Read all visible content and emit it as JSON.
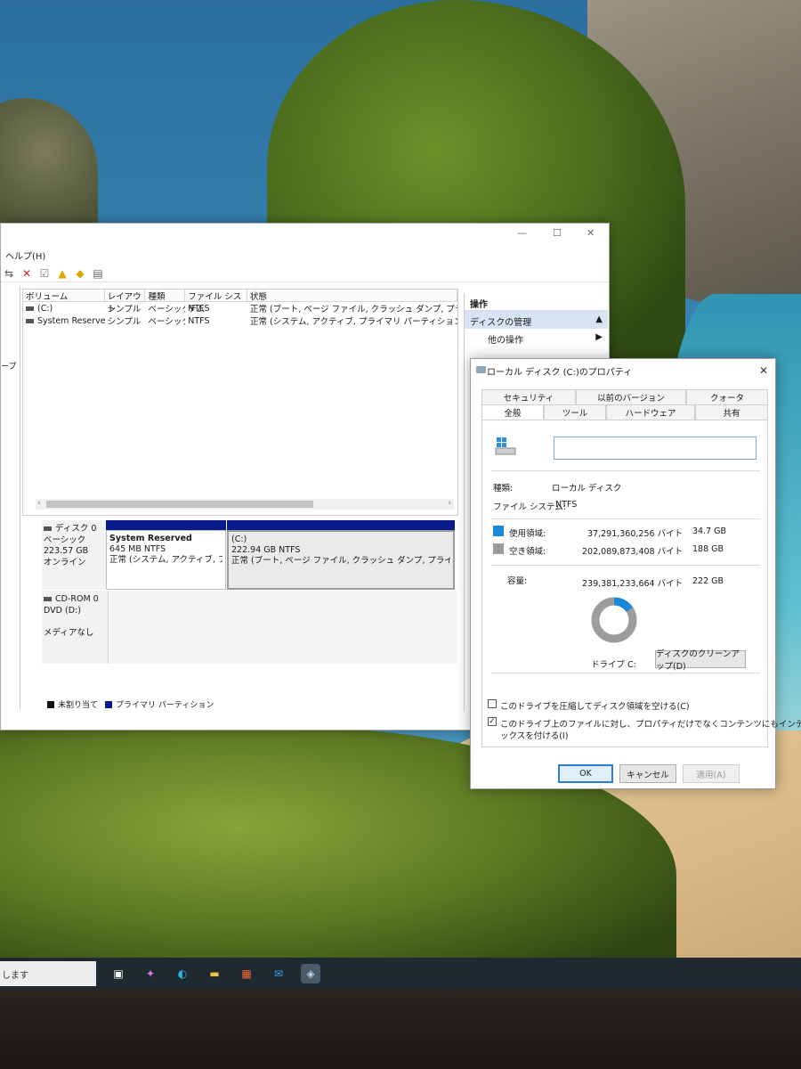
{
  "taskbar": {
    "search_text": "します",
    "icons": [
      "task-view-icon",
      "copilot-icon",
      "edge-icon",
      "file-explorer-icon",
      "store-icon",
      "mail-icon",
      "disk-management-icon"
    ]
  },
  "disk_mgmt": {
    "menu": {
      "help": "ヘルプ(H)"
    },
    "left_strip_text": "ープ",
    "columns": [
      "ボリューム",
      "レイアウト",
      "種類",
      "ファイル システム",
      "状態"
    ],
    "volumes": [
      {
        "name": "(C:)",
        "layout": "シンプル",
        "type": "ベーシック",
        "fs": "NTFS",
        "status": "正常 (ブート, ページ ファイル, クラッシュ ダンプ, プライマリ パーティ"
      },
      {
        "name": "System Reserved",
        "layout": "シンプル",
        "type": "ベーシック",
        "fs": "NTFS",
        "status": "正常 (システム, アクティブ, プライマリ パーティション)"
      }
    ],
    "disk0": {
      "name": "ディスク 0",
      "type": "ベーシック",
      "size": "223.57 GB",
      "state": "オンライン",
      "partitions": [
        {
          "name": "System Reserved",
          "size": "645 MB NTFS",
          "status": "正常 (システム, アクティブ, プライマ"
        },
        {
          "name": "(C:)",
          "size": "222.94 GB NTFS",
          "status": "正常 (ブート, ページ ファイル, クラッシュ ダンプ, プライマリ パーティション)"
        }
      ]
    },
    "cdrom": {
      "name": "CD-ROM 0",
      "drive": "DVD (D:)",
      "media": "メディアなし"
    },
    "legend": {
      "unallocated": "未割り当て",
      "primary": "プライマリ パーティション"
    },
    "actions": {
      "header": "操作",
      "selected": "ディスクの管理",
      "other": "他の操作"
    },
    "colors": {
      "partition_bar": "#0a1c8c",
      "unallocated": "#111111",
      "selection": "#d7e4f3"
    }
  },
  "properties": {
    "title": "ローカル ディスク (C:)のプロパティ",
    "tabs_back": [
      "セキュリティ",
      "以前のバージョン",
      "クォータ"
    ],
    "tabs_front": [
      "全般",
      "ツール",
      "ハードウェア",
      "共有"
    ],
    "active_tab": "全般",
    "volume_label_value": "",
    "type_label": "種類:",
    "type_value": "ローカル ディスク",
    "fs_label": "ファイル システム:",
    "fs_value": "NTFS",
    "used_label": "使用領域:",
    "used_bytes": "37,291,360,256 バイト",
    "used_gb": "34.7 GB",
    "free_label": "空き領域:",
    "free_bytes": "202,089,873,408 バイト",
    "free_gb": "188 GB",
    "capacity_label": "容量:",
    "capacity_bytes": "239,381,233,664 バイト",
    "capacity_gb": "222 GB",
    "drive_label": "ドライブ C:",
    "cleanup_button": "ディスクのクリーンアップ(D)",
    "compress_label": "このドライブを圧縮してディスク領域を空ける(C)",
    "compress_checked": false,
    "index_label_line1": "このドライブ上のファイルに対し、プロパティだけでなくコンテンツにもインデ",
    "index_label_line2": "ックスを付ける(I)",
    "index_checked": true,
    "used_fraction": 0.1558,
    "colors": {
      "used": "#1e88d8",
      "free": "#9c9c9c"
    },
    "buttons": {
      "ok": "OK",
      "cancel": "キャンセル",
      "apply": "適用(A)"
    }
  }
}
